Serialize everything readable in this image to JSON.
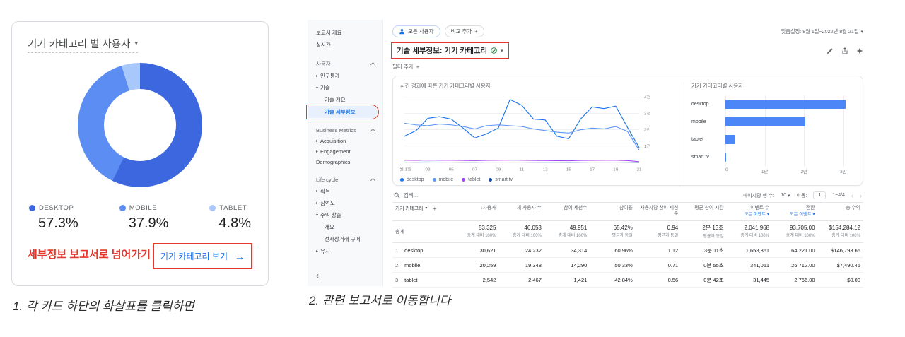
{
  "icons": {
    "caret_down": "▾",
    "caret_right": "▸",
    "arrow_right": "→",
    "plus": "+",
    "sort_desc": "↓",
    "collapse": "‹",
    "chevron_left": "‹",
    "chevron_right": "›"
  },
  "colors": {
    "annotation_red": "#e5372b",
    "link_blue": "#1a73e8"
  },
  "captions": {
    "step1": "1. 각 카드 하단의 화살표를 클릭하면",
    "step2": "2. 관련 보고서로 이동합니다"
  },
  "left_card": {
    "title": "기기 카테고리 별 사용자",
    "legend": [
      {
        "label": "DESKTOP",
        "pct": "57.3%",
        "value": 57.3,
        "color": "#3c67de"
      },
      {
        "label": "MOBILE",
        "pct": "37.9%",
        "value": 37.9,
        "color": "#5b8df2"
      },
      {
        "label": "TABLET",
        "pct": "4.8%",
        "value": 4.8,
        "color": "#a8c7fa"
      }
    ],
    "cta_text": "세부정보 보고서로 넘어가기",
    "link_label": "기기 카테고리 보기",
    "link_arrow": "→"
  },
  "ga": {
    "sidebar": {
      "top_items": [
        {
          "label": "보고서 개요"
        },
        {
          "label": "실시간"
        }
      ],
      "sections": [
        {
          "title": "사용자",
          "items": [
            {
              "label": "인구통계",
              "arrow": "▸"
            },
            {
              "label": "기술",
              "arrow": "▾",
              "children": [
                {
                  "label": "기술 개요"
                },
                {
                  "label": "기술 세부정보",
                  "selected": true,
                  "outlined": true
                }
              ]
            }
          ]
        },
        {
          "title": "Business Metrics",
          "items": [
            {
              "label": "Acquisition",
              "arrow": "▸"
            },
            {
              "label": "Engagement",
              "arrow": "▸"
            },
            {
              "label": "Demographics"
            }
          ]
        },
        {
          "title": "Life cycle",
          "items": [
            {
              "label": "획득",
              "arrow": "▸"
            },
            {
              "label": "참여도",
              "arrow": "▸"
            },
            {
              "label": "수익 창출",
              "arrow": "▾",
              "children": [
                {
                  "label": "개요"
                },
                {
                  "label": "전자상거래 구매"
                }
              ]
            },
            {
              "label": "유지",
              "arrow": "▸"
            }
          ]
        }
      ],
      "collapse_icon": "‹"
    },
    "topbar": {
      "audience_chip": "모든 사용자",
      "compare_chip": "비교 추가",
      "date_range": "맞춤설정: 8월 1일~2022년 8월 21일"
    },
    "title": "기술 세부정보: 기기 카테고리",
    "filter_label": "필터 추가",
    "table": {
      "search_placeholder": "검색...",
      "pagination": {
        "rows_per_page_label": "페이지당 행 수:",
        "rows_per_page": "10",
        "goto_label": "이동:",
        "goto": "1",
        "range": "1~4/4"
      },
      "columns": [
        {
          "label": "기기 카테고리",
          "first": true
        },
        {
          "label": "사용자",
          "sorted": true
        },
        {
          "label": "새 사용자 수"
        },
        {
          "label": "참여 세션수"
        },
        {
          "label": "참여율"
        },
        {
          "label": "사용자당 참여 세션수"
        },
        {
          "label": "평균 참여 시간"
        },
        {
          "label": "이벤트 수",
          "sub": "모든 이벤트"
        },
        {
          "label": "전환",
          "sub": "모든 이벤트"
        },
        {
          "label": "총 수익"
        }
      ],
      "totals": {
        "label": "총계",
        "values": [
          "53,325",
          "46,053",
          "49,951",
          "65.42%",
          "0.94",
          "2분 13초",
          "2,041,968",
          "93,705.00",
          "$154,284.12"
        ],
        "subs": [
          "총계 대비 100%",
          "총계 대비 100%",
          "총계 대비 100%",
          "평균과 동일",
          "평균과 동일",
          "평균과 동일",
          "총계 대비 100%",
          "총계 대비 100%",
          "총계 대비 100%"
        ]
      },
      "rows": [
        {
          "num": "1",
          "name": "desktop",
          "values": [
            "30,621",
            "24,232",
            "34,314",
            "60.96%",
            "1.12",
            "3분 11초",
            "1,658,361",
            "64,221.00",
            "$146,793.66"
          ]
        },
        {
          "num": "2",
          "name": "mobile",
          "values": [
            "20,259",
            "19,348",
            "14,290",
            "50.33%",
            "0.71",
            "0분 55초",
            "341,051",
            "26,712.00",
            "$7,490.46"
          ]
        },
        {
          "num": "3",
          "name": "tablet",
          "values": [
            "2,542",
            "2,467",
            "1,421",
            "42.84%",
            "0.56",
            "0분 42초",
            "31,445",
            "2,766.00",
            "$0.00"
          ]
        }
      ]
    }
  },
  "chart_data": [
    {
      "type": "line",
      "title": "시간 경과에 따른 기기 카테고리별 사용자",
      "x": [
        1,
        2,
        3,
        4,
        5,
        6,
        7,
        8,
        9,
        10,
        11,
        12,
        13,
        14,
        15,
        16,
        17,
        18,
        19,
        20,
        21
      ],
      "x_ticks": [
        {
          "pos": 0,
          "label": "8월 1일"
        },
        {
          "pos": 2,
          "label": "03"
        },
        {
          "pos": 4,
          "label": "05"
        },
        {
          "pos": 6,
          "label": "07"
        },
        {
          "pos": 8,
          "label": "09"
        },
        {
          "pos": 10,
          "label": "11"
        },
        {
          "pos": 12,
          "label": "13"
        },
        {
          "pos": 14,
          "label": "15"
        },
        {
          "pos": 16,
          "label": "17"
        },
        {
          "pos": 18,
          "label": "19"
        },
        {
          "pos": 20,
          "label": "21"
        }
      ],
      "ylim": [
        0,
        4000
      ],
      "ygrid": [
        {
          "v": 1000,
          "label": "1천"
        },
        {
          "v": 2000,
          "label": "2천"
        },
        {
          "v": 3000,
          "label": "3천"
        },
        {
          "v": 4000,
          "label": "4천"
        }
      ],
      "legend_position": "bottom",
      "series": [
        {
          "name": "desktop",
          "color": "#1a73e8",
          "values": [
            1600,
            1950,
            2700,
            2800,
            2650,
            2100,
            1500,
            1750,
            2100,
            3850,
            3500,
            2650,
            2600,
            1600,
            1450,
            2650,
            3400,
            3300,
            3450,
            2150,
            900
          ]
        },
        {
          "name": "mobile",
          "color": "#5e97f6",
          "values": [
            2400,
            2300,
            2250,
            2350,
            2300,
            2200,
            2050,
            2250,
            2300,
            2250,
            2200,
            2050,
            1950,
            1850,
            1800,
            2000,
            2100,
            2050,
            2200,
            1900,
            750
          ]
        },
        {
          "name": "tablet",
          "color": "#a142f4",
          "values": [
            130,
            125,
            140,
            135,
            130,
            120,
            110,
            125,
            130,
            140,
            130,
            120,
            115,
            105,
            100,
            120,
            125,
            130,
            135,
            110,
            45
          ]
        },
        {
          "name": "smart tv",
          "color": "#174ea6",
          "values": [
            15,
            12,
            18,
            14,
            16,
            12,
            10,
            14,
            15,
            16,
            14,
            12,
            11,
            10,
            9,
            13,
            14,
            15,
            16,
            10,
            4
          ]
        }
      ]
    },
    {
      "type": "bar",
      "title": "기기 카테고리별 사용자",
      "orientation": "horizontal",
      "categories": [
        "desktop",
        "mobile",
        "tablet",
        "smart tv"
      ],
      "values": [
        30621,
        20259,
        2542,
        103
      ],
      "xlim": [
        0,
        32000
      ],
      "x_ticks": [
        {
          "v": 0,
          "label": "0"
        },
        {
          "v": 10000,
          "label": "1만"
        },
        {
          "v": 20000,
          "label": "2만"
        },
        {
          "v": 30000,
          "label": "3만"
        }
      ],
      "bar_color": "#4c86f7"
    }
  ]
}
